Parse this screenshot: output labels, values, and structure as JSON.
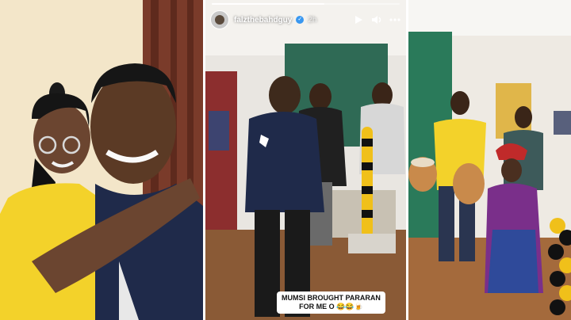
{
  "story": {
    "username": "falzthebahdguy",
    "time": "2h",
    "progress": 0.6,
    "icons": [
      "play-icon",
      "volume-icon",
      "more-icon"
    ]
  },
  "caption": {
    "line1": "MUMSI BROUGHT PARARAN",
    "line2": "FOR ME O 😂😂🍺"
  },
  "colors": {
    "yellow_shirt": "#f3d22a",
    "jersey_navy": "#1f2a4a",
    "wall": "#f3e6c9",
    "floor": "#8a5a36",
    "drum": "#c98a4b"
  }
}
